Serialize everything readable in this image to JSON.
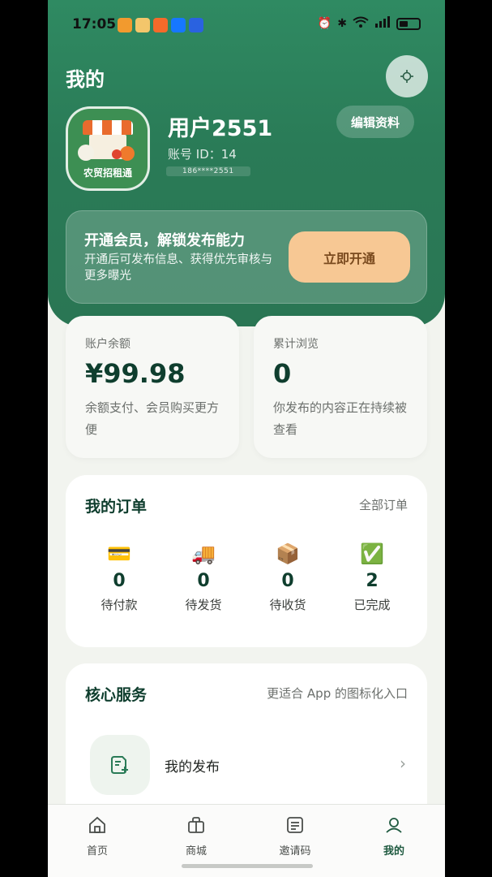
{
  "status_bar": {
    "time": "17:05"
  },
  "header": {
    "title": "我的"
  },
  "profile": {
    "avatar_label": "农贸招租通",
    "name": "用户2551",
    "account_id": "账号 ID：14",
    "phone": "186****2551",
    "edit_label": "编辑资料"
  },
  "vip": {
    "title": "开通会员，解锁发布能力",
    "desc": "开通后可发布信息、获得优先审核与更多曝光",
    "button": "立即开通"
  },
  "stats": [
    {
      "label": "账户余额",
      "value": "¥99.98",
      "desc": "余额支付、会员购买更方便"
    },
    {
      "label": "累计浏览",
      "value": "0",
      "desc": "你发布的内容正在持续被查看"
    }
  ],
  "orders": {
    "title": "我的订单",
    "link": "全部订单",
    "items": [
      {
        "icon": "credit-card-icon",
        "glyph": "💳",
        "count": "0",
        "label": "待付款"
      },
      {
        "icon": "truck-icon",
        "glyph": "🚚",
        "count": "0",
        "label": "待发货"
      },
      {
        "icon": "package-icon",
        "glyph": "📦",
        "count": "0",
        "label": "待收货"
      },
      {
        "icon": "check-mark-icon",
        "glyph": "✅",
        "count": "2",
        "label": "已完成"
      }
    ]
  },
  "services": {
    "title": "核心服务",
    "subtitle": "更适合 App 的图标化入口",
    "items": [
      {
        "icon": "document-add-icon",
        "label": "我的发布"
      }
    ]
  },
  "tabbar": {
    "items": [
      {
        "icon": "home-icon",
        "label": "首页"
      },
      {
        "icon": "shop-icon",
        "label": "商城"
      },
      {
        "icon": "invite-code-icon",
        "label": "邀请码"
      },
      {
        "icon": "user-icon",
        "label": "我的"
      }
    ],
    "active_index": 3
  },
  "colors": {
    "brand": "#2a7b57",
    "brand_dark": "#0f3e2e",
    "vip_button": "#f7c894",
    "page_bg": "#f2f4ef"
  }
}
